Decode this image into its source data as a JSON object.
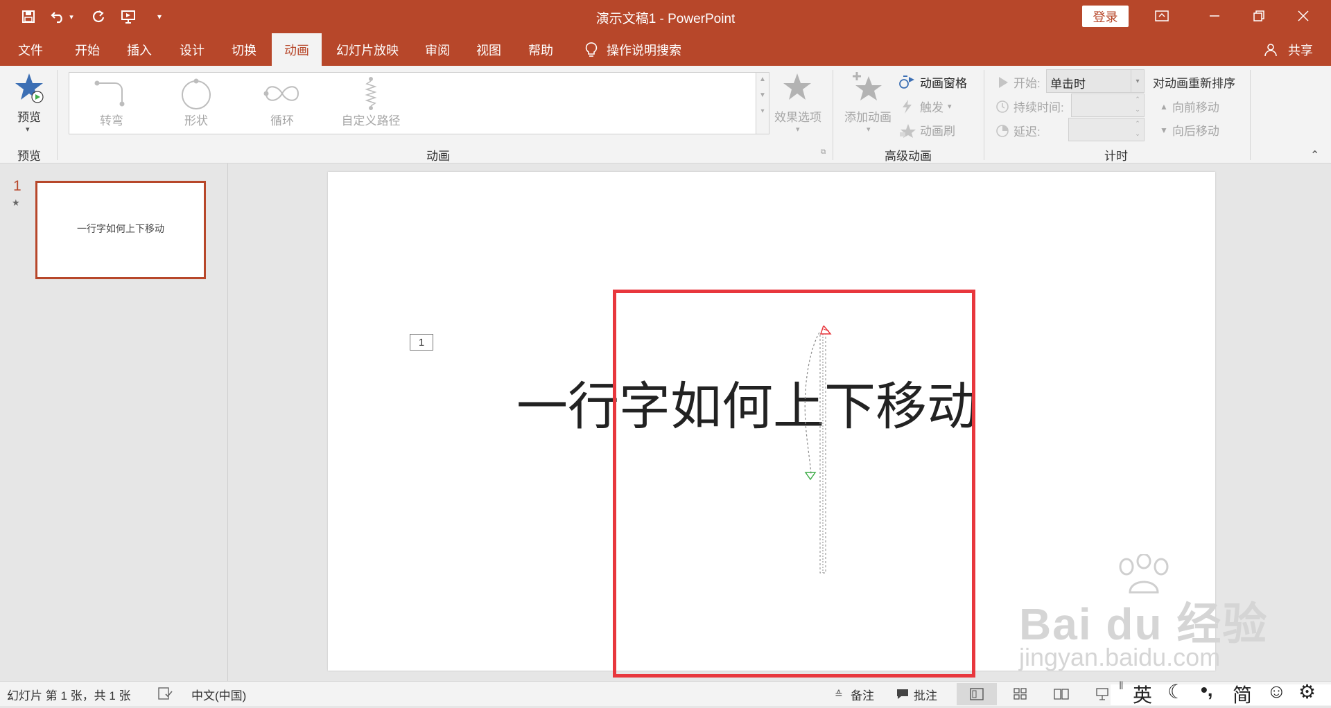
{
  "title_bar": {
    "title": "演示文稿1  -  PowerPoint",
    "login_label": "登录"
  },
  "tabs": [
    "文件",
    "开始",
    "插入",
    "设计",
    "切换",
    "动画",
    "幻灯片放映",
    "审阅",
    "视图",
    "帮助"
  ],
  "tell_me": "操作说明搜索",
  "share_label": "共享",
  "ribbon": {
    "preview_button": "预览",
    "preview_group": "预览",
    "gallery": [
      "转弯",
      "形状",
      "循环",
      "自定义路径"
    ],
    "effect_options": "效果选项",
    "animation_group": "动画",
    "add_animation": "添加动画",
    "animation_pane": "动画窗格",
    "trigger": "触发",
    "animation_painter": "动画刷",
    "advanced_group": "高级动画",
    "start_label": "开始:",
    "start_value": "单击时",
    "duration_label": "持续时间:",
    "delay_label": "延迟:",
    "reorder_title": "对动画重新排序",
    "move_earlier": "向前移动",
    "move_later": "向后移动",
    "timing_group": "计时"
  },
  "slides_pane": {
    "slide_number": "1",
    "thumb_text": "一行字如何上下移动"
  },
  "slide": {
    "title": "一行字如何上下移动",
    "animation_tag": "1"
  },
  "status_bar": {
    "slide_info": "幻灯片 第 1 张，共 1 张",
    "language": "中文(中国)",
    "notes": "备注",
    "comments": "批注"
  },
  "ime": {
    "lang": "英",
    "punct": "•,",
    "mode": "简"
  },
  "watermark": {
    "brand": "Bai du 经验",
    "url": "jingyan.baidu.com"
  },
  "colors": {
    "accent": "#b7472a",
    "highlight": "#e8373d"
  }
}
